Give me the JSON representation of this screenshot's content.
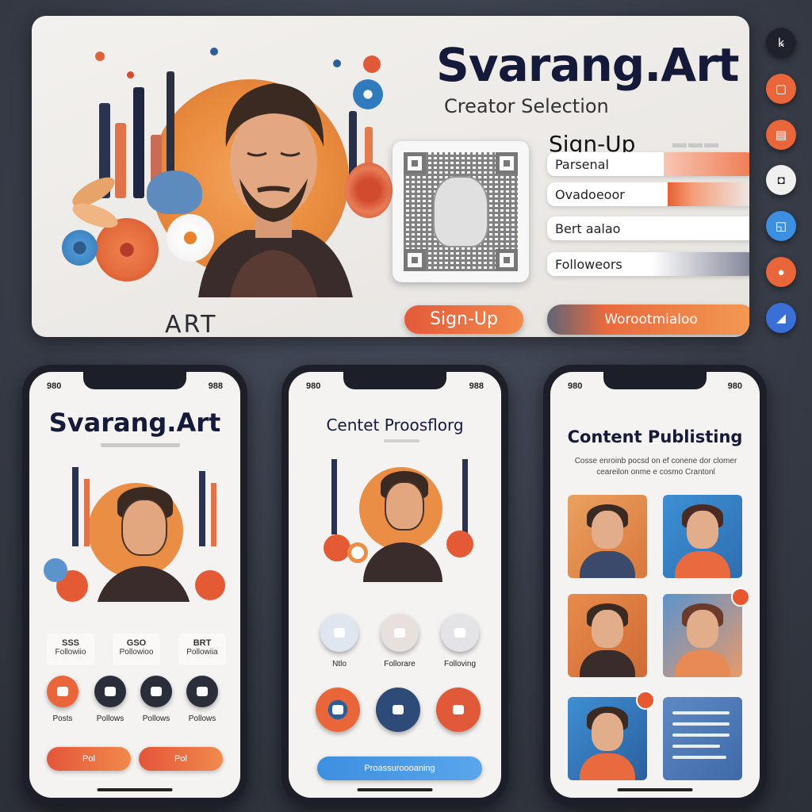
{
  "banner": {
    "brand": "Svarang.Art",
    "subtitle": "Creator Selection",
    "art_caption": "ART",
    "signup_title": "Sign-Up",
    "fields": [
      "Parsenal",
      "Ovadoeoor",
      "Bert aalao",
      "Followeors"
    ],
    "signup_button": "Sign-Up",
    "wide_button": "Worootmialoo"
  },
  "colors": {
    "accent_orange": "#e86a3e",
    "accent_blue": "#3d8fe0",
    "navy": "#151a3a",
    "background": "#353a45"
  },
  "rail_icons": [
    "profile-icon",
    "camera-icon",
    "book-icon",
    "play-icon",
    "share-icon",
    "record-icon",
    "chat-icon"
  ],
  "phone1": {
    "status_left": "980",
    "status_right": "988",
    "title": "Svarang.Art",
    "stats": [
      {
        "value": "SSS",
        "label": "Followiio"
      },
      {
        "value": "GSO",
        "label": "Pollowioo"
      },
      {
        "value": "BRT",
        "label": "Pollowiia"
      }
    ],
    "actions": [
      "Posts",
      "Pollows",
      "Pollows",
      "Pollows"
    ],
    "buttons": [
      "Pol",
      "Pol"
    ]
  },
  "phone2": {
    "status_left": "980",
    "status_right": "988",
    "title": "Centet Proosflorg",
    "row1": [
      "Ntlo",
      "Follorare",
      "Folloving"
    ],
    "button": "Proassuroooaning"
  },
  "phone3": {
    "status_left": "980",
    "status_right": "980",
    "title": "Content Publisting",
    "description": "Cosse enroinb pocsd on ef conene dor clomer ceareilon onme e cosmo Crantonl"
  }
}
